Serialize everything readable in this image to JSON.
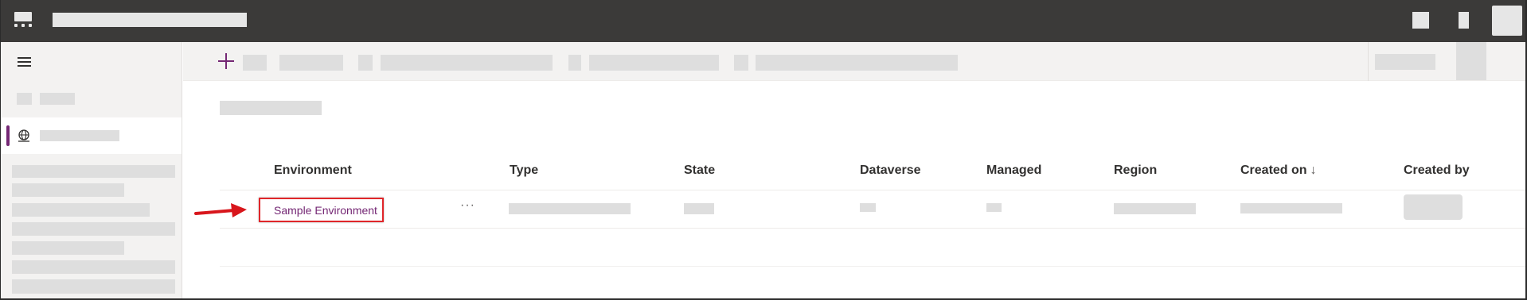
{
  "colors": {
    "topbar": "#3b3a39",
    "accent": "#742774",
    "highlight_box": "#e0262a",
    "placeholder": "#dedede"
  },
  "topbar": {
    "app_icon": "waffle-icon",
    "right_icons": [
      "settings-icon",
      "help-icon",
      "avatar"
    ]
  },
  "sidebar": {
    "menu_icon": "hamburger-icon",
    "active_item_icon": "globe-icon"
  },
  "command_bar": {
    "new_icon": "plus-icon"
  },
  "table": {
    "columns": [
      "Environment",
      "Type",
      "State",
      "Dataverse",
      "Managed",
      "Region",
      "Created on",
      "Created by"
    ],
    "sort_indicator": "↓",
    "rows": [
      {
        "environment": "Sample Environment",
        "more_actions": "···"
      }
    ]
  },
  "annotation": {
    "icon": "red-arrow-icon"
  }
}
